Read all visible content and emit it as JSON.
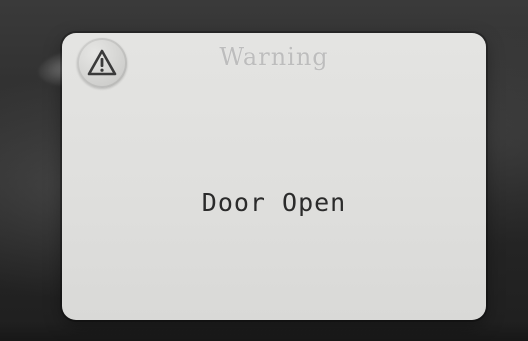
{
  "dialog": {
    "title": "Warning",
    "message": "Door Open",
    "icon": "warning-icon",
    "colors": {
      "background": "#e0e0de",
      "title": "#bdbdbd",
      "message": "#2b2b2b",
      "icon_stroke": "#3a3a3a"
    }
  }
}
